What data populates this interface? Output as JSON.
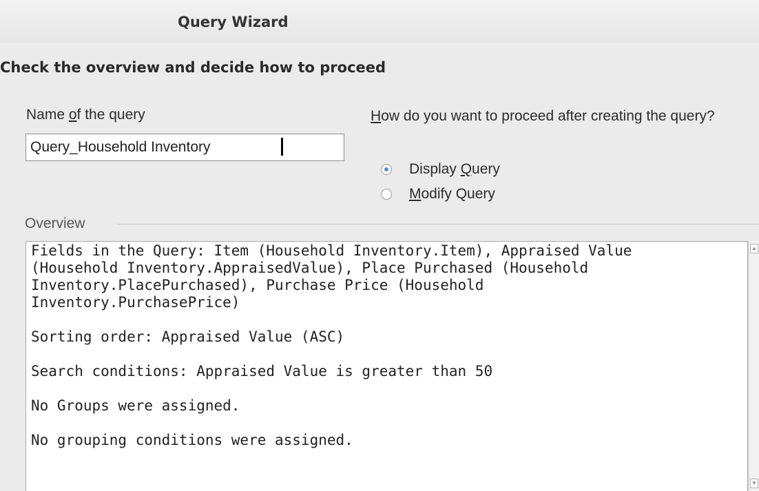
{
  "window": {
    "title": "Query Wizard"
  },
  "step": {
    "heading": "Check the overview and decide how to proceed"
  },
  "query_name": {
    "label_pre": "Name ",
    "label_mnemonic": "o",
    "label_post": "f the query",
    "value": "Query_Household Inventory"
  },
  "proceed": {
    "label_mnemonic": "H",
    "label_post": "ow do you want to proceed after creating the query?",
    "options": [
      {
        "pre": "Display ",
        "mnemonic": "Q",
        "post": "uery",
        "checked": true
      },
      {
        "pre": "",
        "mnemonic": "M",
        "post": "odify Query",
        "checked": false
      }
    ]
  },
  "overview": {
    "legend": "Overview",
    "text": "Fields in the Query: Item (Household Inventory.Item), Appraised Value\n(Household Inventory.AppraisedValue), Place Purchased (Household\nInventory.PlacePurchased), Purchase Price (Household\nInventory.PurchasePrice)\n\nSorting order: Appraised Value (ASC)\n\nSearch conditions: Appraised Value is greater than 50\n\nNo Groups were assigned.\n\nNo grouping conditions were assigned."
  },
  "icons": {
    "scroll_up": "chevron-up-icon",
    "scroll_down": "chevron-down-icon"
  }
}
